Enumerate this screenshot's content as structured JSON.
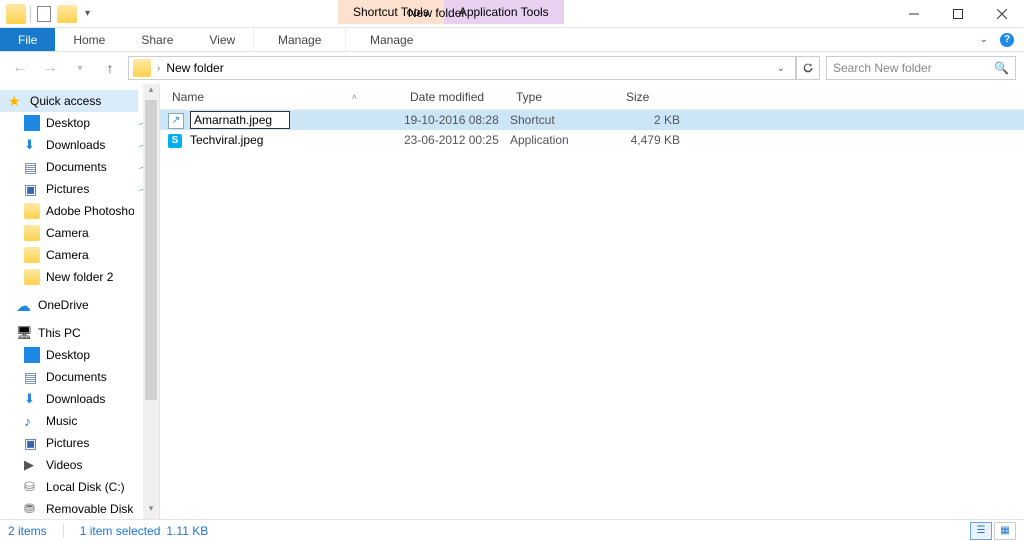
{
  "title": "New folder",
  "toolTabs": {
    "shortcut": "Shortcut Tools",
    "application": "Application Tools"
  },
  "ribbon": {
    "file": "File",
    "home": "Home",
    "share": "Share",
    "view": "View",
    "manage1": "Manage",
    "manage2": "Manage"
  },
  "nav": {
    "crumb": "New folder",
    "searchPlaceholder": "Search New folder"
  },
  "sidebar": {
    "quickAccess": "Quick access",
    "desktop": "Desktop",
    "downloads": "Downloads",
    "documents": "Documents",
    "pictures": "Pictures",
    "adobe": "Adobe Photoshop",
    "camera1": "Camera",
    "camera2": "Camera",
    "newfolder2": "New folder 2",
    "onedrive": "OneDrive",
    "thispc": "This PC",
    "pcdesktop": "Desktop",
    "pcdocs": "Documents",
    "pcdown": "Downloads",
    "pcmusic": "Music",
    "pcpics": "Pictures",
    "pcvids": "Videos",
    "localdisk": "Local Disk (C:)",
    "removable": "Removable Disk"
  },
  "columns": {
    "name": "Name",
    "date": "Date modified",
    "type": "Type",
    "size": "Size"
  },
  "files": [
    {
      "name": "Amarnath.jpeg",
      "date": "19-10-2016 08:28",
      "type": "Shortcut",
      "size": "2 KB"
    },
    {
      "name": "Techviral.jpeg",
      "date": "23-06-2012 00:25",
      "type": "Application",
      "size": "4,479 KB"
    }
  ],
  "status": {
    "items": "2 items",
    "selected": "1 item selected",
    "size": "1.11 KB"
  }
}
